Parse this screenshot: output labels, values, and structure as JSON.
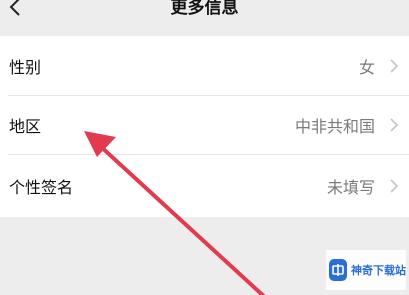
{
  "header": {
    "title": "更多信息",
    "back_icon": "chevron-left-icon"
  },
  "rows": [
    {
      "label": "性别",
      "value": "女"
    },
    {
      "label": "地区",
      "value": "中非共和国"
    },
    {
      "label": "个性签名",
      "value": "未填写"
    }
  ],
  "row_chevron_icon": "chevron-right-icon",
  "annotation": {
    "color": "#e23a4e"
  },
  "watermark": {
    "text": "神奇下载站",
    "logo_icon": "site-logo-icon"
  },
  "colors": {
    "background": "#ededed",
    "value_text": "#7a7a7a",
    "watermark_blue": "#2a6fd8"
  }
}
